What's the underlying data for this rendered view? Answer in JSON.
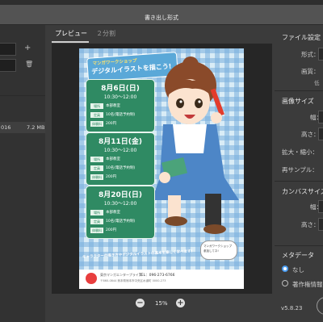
{
  "dialog": {
    "title": "書き出し形式"
  },
  "left_panel": {
    "plus_icon": "+",
    "trash_icon": "🗑",
    "file_row": {
      "name": "016",
      "size": "7.2 MB"
    }
  },
  "preview": {
    "tabs": [
      {
        "label": "プレビュー",
        "active": true
      },
      {
        "label": "２分割",
        "active": false
      }
    ],
    "zoom": {
      "minus": "−",
      "value": "15%",
      "plus": "+"
    }
  },
  "poster": {
    "banner_line1": "マンガワークショップ",
    "banner_line2": "デジタルイラストを描こう!",
    "events": [
      {
        "date": "8月6日(日)",
        "time": "10:30〜12:00",
        "rows": [
          {
            "label": "場所",
            "value": "本部教室"
          },
          {
            "label": "定員",
            "value": "10名(電話予約制)"
          },
          {
            "label": "体験料",
            "value": "200円"
          }
        ]
      },
      {
        "date": "8月11日(金)",
        "time": "10:30〜12:00",
        "rows": [
          {
            "label": "場所",
            "value": "本部教室"
          },
          {
            "label": "定員",
            "value": "10名(電話予約制)"
          },
          {
            "label": "体験料",
            "value": "200円"
          }
        ]
      },
      {
        "date": "8月20日(日)",
        "time": "10:30〜12:00",
        "rows": [
          {
            "label": "場所",
            "value": "本部教室"
          },
          {
            "label": "定員",
            "value": "10名(電話予約制)"
          },
          {
            "label": "体験料",
            "value": "200円"
          }
        ]
      }
    ],
    "tagline": "キャラクターの描き方やデジタルイラストの基本を楽しく学べます!",
    "speech_line1": "マンガワークショップ",
    "speech_line2": "参加してネ!",
    "footer": {
      "name": "東京マンガエンタープライズ",
      "tel": "TEL：096-273-6766",
      "addr": "〒860-0844 熊本県熊本市中央区水道町 0000-273"
    }
  },
  "right_panel": {
    "file_settings": "ファイル設定",
    "format_label": "形式：",
    "quality_label": "画質：",
    "quality_value": "低",
    "image_size": "画像サイズ",
    "width_label": "幅：",
    "height_label": "高さ：",
    "scale_label": "拡大・縮小：",
    "resample_label": "再サンプル：",
    "canvas_size": "カンバスサイズ",
    "canvas_width_label": "幅：",
    "canvas_height_label": "高さ：",
    "metadata": "メタデータ",
    "meta_none": "なし",
    "meta_copyright": "著作権情報"
  },
  "footer": {
    "version": "v5.8.23"
  }
}
